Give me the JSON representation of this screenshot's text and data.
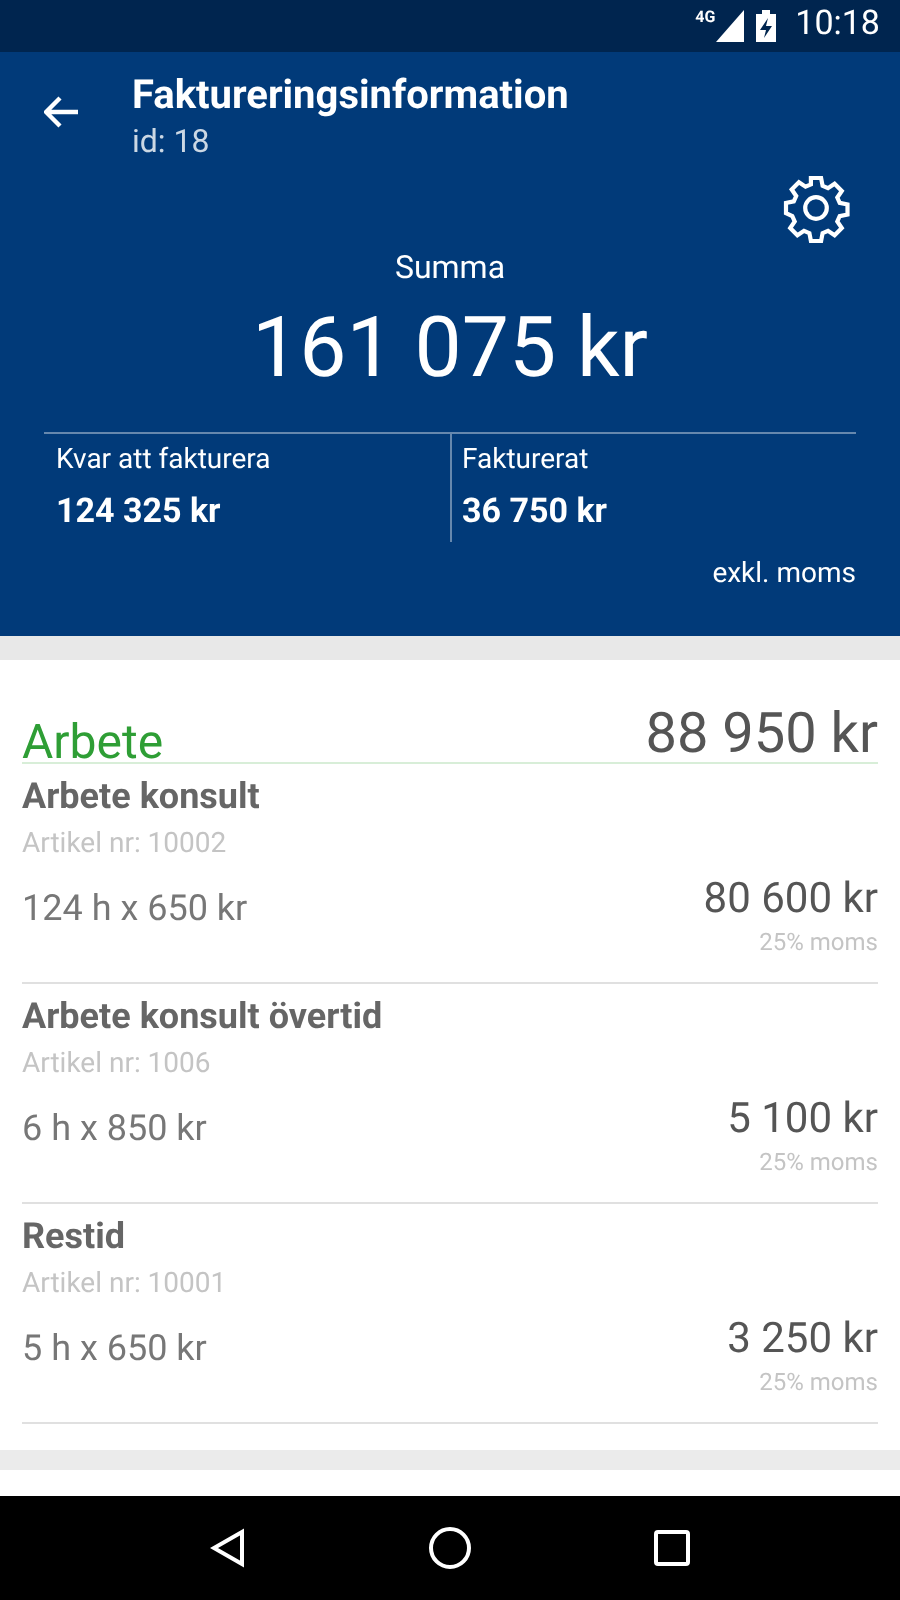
{
  "status_bar": {
    "network": "4G",
    "time": "10:18"
  },
  "header": {
    "title": "Faktureringsinformation",
    "subtitle": "id: 18",
    "sum_label": "Summa",
    "sum": "161 075 kr",
    "stats": [
      {
        "label": "Kvar att fakturera",
        "value": "124 325 kr"
      },
      {
        "label": "Fakturerat",
        "value": "36 750 kr"
      }
    ],
    "note": "exkl. moms"
  },
  "section": {
    "title": "Arbete",
    "color": "#2e9e35",
    "total": "88 950 kr",
    "items": [
      {
        "name": "Arbete konsult",
        "article": "Artikel nr: 10002",
        "quantity": "124 h x 650 kr",
        "price": "80 600 kr",
        "vat": "25% moms"
      },
      {
        "name": "Arbete konsult övertid",
        "article": "Artikel nr: 1006",
        "quantity": "6 h x 850 kr",
        "price": "5 100 kr",
        "vat": "25% moms"
      },
      {
        "name": "Restid",
        "article": "Artikel nr: 10001",
        "quantity": "5 h x 650 kr",
        "price": "3 250 kr",
        "vat": "25% moms"
      }
    ]
  }
}
